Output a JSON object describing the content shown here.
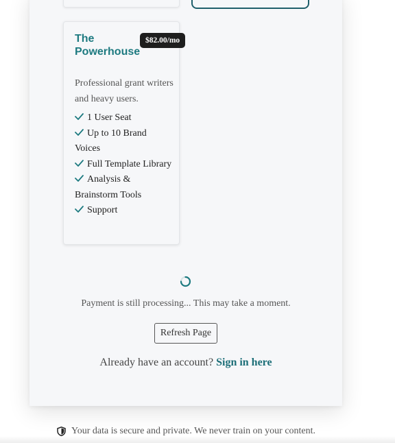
{
  "plan": {
    "title": "The Powerhouse",
    "price": "$82.00/mo",
    "description": "Professional grant writers and heavy users.",
    "features": [
      "1 User Seat",
      "Up to 10 Brand Voices",
      "Full Template Library",
      "Analysis & Brainstorm Tools",
      "Support"
    ]
  },
  "status": {
    "message": "Payment is still processing... This may take a moment.",
    "refresh_label": "Refresh Page"
  },
  "signin": {
    "prompt": "Already have an account?",
    "link_label": "Sign in here"
  },
  "footer": {
    "note": "Your data is secure and private. We never train on your content."
  },
  "colors": {
    "accent": "#1d7a80",
    "badge_bg": "#1e1e1e",
    "card_bg": "#f6f7f9"
  },
  "icons": {
    "feature": "check-icon",
    "loading": "spinner-icon",
    "footer": "shield-icon"
  }
}
